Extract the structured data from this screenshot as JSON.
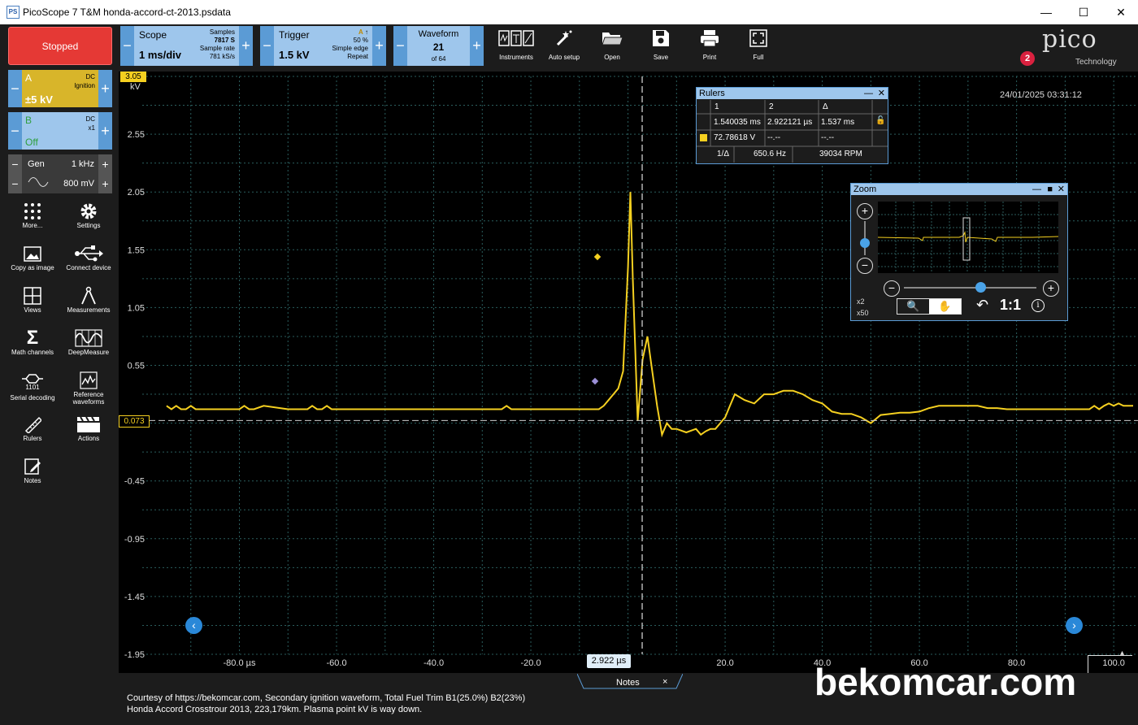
{
  "window": {
    "title": "PicoScope 7 T&M honda-accord-ct-2013.psdata",
    "app_icon": "PS"
  },
  "toolbar": {
    "status": "Stopped",
    "scope": {
      "label": "Scope",
      "timebase": "1 ms/div",
      "samples_label": "Samples",
      "samples": "7817 S",
      "rate_label": "Sample rate",
      "rate": "781 kS/s"
    },
    "trigger": {
      "label": "Trigger",
      "level": "1.5 kV",
      "channel": "A",
      "percent": "50 %",
      "type": "Simple edge",
      "mode": "Repeat"
    },
    "waveform": {
      "label": "Waveform",
      "current": "21",
      "total": "of 64"
    },
    "buttons": [
      {
        "label": "Instruments",
        "icon": "instruments-icon"
      },
      {
        "label": "Auto setup",
        "icon": "auto-setup-icon"
      },
      {
        "label": "Open",
        "icon": "folder-open-icon"
      },
      {
        "label": "Save",
        "icon": "save-icon"
      },
      {
        "label": "Print",
        "icon": "printer-icon"
      },
      {
        "label": "Full",
        "icon": "fullscreen-icon"
      }
    ],
    "notification_count": "2",
    "logo": {
      "brand": "pico",
      "sub": "Technology"
    }
  },
  "channels": {
    "a": {
      "name": "A",
      "coupling": "DC",
      "probe": "Ignition",
      "range": "±5 kV",
      "color": "#f5d020"
    },
    "b": {
      "name": "B",
      "coupling": "DC",
      "probe": "x1",
      "state": "Off",
      "color": "#2e9e3e"
    },
    "gen": {
      "label": "Gen",
      "freq": "1 kHz",
      "amp": "800 mV"
    }
  },
  "sidebar": [
    {
      "label": "More...",
      "icon": "more-dots-icon"
    },
    {
      "label": "Settings",
      "icon": "gear-icon"
    },
    {
      "label": "Copy as image",
      "icon": "image-icon"
    },
    {
      "label": "Connect device",
      "icon": "usb-icon"
    },
    {
      "label": "Views",
      "icon": "views-grid-icon"
    },
    {
      "label": "Measurements",
      "icon": "measurements-icon"
    },
    {
      "label": "Math channels",
      "icon": "sigma-icon"
    },
    {
      "label": "DeepMeasure",
      "icon": "deepmeasure-icon"
    },
    {
      "label": "Serial decoding",
      "icon": "serial-decoding-icon",
      "sub": "1101"
    },
    {
      "label": "Reference waveforms",
      "icon": "reference-waveform-icon"
    },
    {
      "label": "Rulers",
      "icon": "ruler-icon"
    },
    {
      "label": "Actions",
      "icon": "clapper-icon"
    },
    {
      "label": "Notes",
      "icon": "notes-icon"
    }
  ],
  "plot": {
    "timestamp": "24/01/2025 03:31:12",
    "unit": "kV",
    "top_marker": "3.05",
    "trigger_marker": "0.073",
    "ruler_label": "2.922 µs"
  },
  "chart_data": {
    "type": "line",
    "xlabel": "",
    "ylabel": "kV",
    "xlim": [
      -100,
      105
    ],
    "ylim": [
      -1.95,
      3.05
    ],
    "x_ticks": [
      "-80.0 µs",
      "-60.0",
      "-40.0",
      "-20.0",
      "20.0",
      "40.0",
      "60.0",
      "80.0",
      "100.0"
    ],
    "x_tick_values": [
      -80,
      -60,
      -40,
      -20,
      20,
      40,
      60,
      80,
      100
    ],
    "y_ticks": [
      "2.55",
      "2.05",
      "1.55",
      "1.05",
      "0.55",
      "-0.45",
      "-0.95",
      "-1.45",
      "-1.95"
    ],
    "y_tick_values": [
      2.55,
      2.05,
      1.55,
      1.05,
      0.55,
      -0.45,
      -0.95,
      -1.45,
      -1.95
    ],
    "grid": true,
    "series": [
      {
        "color": "#f5d020",
        "x": [
          -95,
          -94,
          -93,
          -92,
          -91,
          -90,
          -89,
          -88,
          -87,
          -86,
          -85,
          -84,
          -83,
          -82,
          -81,
          -80,
          -79,
          -78,
          -77,
          -75,
          -70,
          -66,
          -65,
          -64,
          -63,
          -62,
          -61,
          -60,
          -59,
          -55,
          -50,
          -45,
          -40,
          -35,
          -30,
          -26,
          -25,
          -24,
          -23,
          -22,
          -20,
          -15,
          -10,
          -6,
          -5,
          -4,
          -3,
          -2,
          -1,
          0,
          0.5,
          1,
          2,
          3,
          4,
          5,
          6,
          7,
          8,
          9,
          10,
          12,
          14,
          15,
          16,
          17,
          18,
          19,
          20,
          21,
          22,
          24,
          26,
          28,
          30,
          32,
          34,
          36,
          38,
          40,
          42,
          44,
          46,
          48,
          50,
          52,
          54,
          56,
          58,
          60,
          62,
          64,
          66,
          68,
          70,
          72,
          74,
          76,
          78,
          80,
          85,
          90,
          95,
          96,
          97,
          98,
          99,
          100,
          101,
          102,
          103,
          104
        ],
        "y": [
          0.2,
          0.17,
          0.2,
          0.17,
          0.17,
          0.2,
          0.17,
          0.17,
          0.17,
          0.17,
          0.17,
          0.17,
          0.17,
          0.17,
          0.17,
          0.17,
          0.2,
          0.17,
          0.17,
          0.2,
          0.17,
          0.17,
          0.2,
          0.17,
          0.17,
          0.2,
          0.17,
          0.17,
          0.17,
          0.17,
          0.17,
          0.17,
          0.17,
          0.17,
          0.17,
          0.17,
          0.2,
          0.17,
          0.17,
          0.17,
          0.17,
          0.17,
          0.17,
          0.17,
          0.2,
          0.25,
          0.3,
          0.35,
          0.5,
          1.4,
          2.05,
          1.3,
          0.07,
          0.6,
          0.8,
          0.5,
          0.2,
          -0.05,
          0.05,
          0.0,
          0.0,
          -0.03,
          0.0,
          -0.05,
          -0.02,
          0.0,
          0.0,
          0.05,
          0.1,
          0.2,
          0.3,
          0.25,
          0.22,
          0.3,
          0.3,
          0.33,
          0.33,
          0.3,
          0.25,
          0.22,
          0.15,
          0.13,
          0.13,
          0.1,
          0.05,
          0.12,
          0.13,
          0.14,
          0.14,
          0.15,
          0.18,
          0.2,
          0.2,
          0.2,
          0.2,
          0.2,
          0.18,
          0.18,
          0.17,
          0.17,
          0.17,
          0.17,
          0.17,
          0.2,
          0.17,
          0.2,
          0.22,
          0.2,
          0.22,
          0.2,
          0.2,
          0.2
        ]
      }
    ],
    "ruler_x": 2.922,
    "trigger_level": 0.073
  },
  "rulers": {
    "title": "Rulers",
    "headers": [
      "1",
      "2",
      "Δ"
    ],
    "row_time": [
      "1.540035 ms",
      "2.922121 µs",
      "1.537 ms"
    ],
    "row_volt": [
      "72.78618 V",
      "--.--",
      "--.--"
    ],
    "freq_label": "1/Δ",
    "freq": "650.6 Hz",
    "rpm": "39034 RPM"
  },
  "zoom": {
    "title": "Zoom",
    "x2": "x2",
    "x50": "x50",
    "ratio": "1:1"
  },
  "notes": {
    "tab": "Notes",
    "line1": "Courtesy of https://bekomcar.com, Secondary ignition waveform, Total Fuel Trim B1(25.0%) B2(23%)",
    "line2": "Honda Accord Crosstrour 2013, 223,179km. Plasma point kV is way down."
  },
  "watermark": "bekomcar.com"
}
